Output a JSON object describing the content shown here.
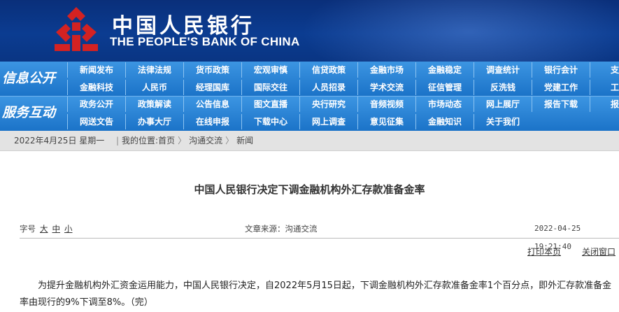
{
  "header": {
    "bank_name_cn": "中国人民银行",
    "bank_name_en": "THE PEOPLE'S BANK OF CHINA",
    "logo_icon": "pboc-logo-icon",
    "logo_color": "#d32222"
  },
  "nav": {
    "section1_label": "信息公开",
    "section2_label": "服务互动",
    "row1": [
      "新闻发布",
      "法律法规",
      "货币政策",
      "宏观审慎",
      "信贷政策",
      "金融市场",
      "金融稳定",
      "调查统计",
      "银行会计",
      "支付"
    ],
    "row2": [
      "金融科技",
      "人民币",
      "经理国库",
      "国际交往",
      "人员招录",
      "学术交流",
      "征信管理",
      "反洗钱",
      "党建工作",
      "工会"
    ],
    "row3": [
      "政务公开",
      "政策解读",
      "公告信息",
      "图文直播",
      "央行研究",
      "音频视频",
      "市场动态",
      "网上展厅",
      "报告下载",
      "报刊"
    ],
    "row4": [
      "网送文告",
      "办事大厅",
      "在线申报",
      "下载中心",
      "网上调查",
      "意见征集",
      "金融知识",
      "关于我们"
    ]
  },
  "breadcrumb": {
    "date": "2022年4月25日 星期一",
    "prefix": "我的位置:",
    "items": [
      "首页",
      "沟通交流",
      "新闻"
    ]
  },
  "article": {
    "title": "中国人民银行决定下调金融机构外汇存款准备金率",
    "font_size_label": "字号",
    "font_size_options": [
      "大",
      "中",
      "小"
    ],
    "source": "文章来源：沟通交流",
    "time": "2022-04-25 19:21:40",
    "print_label": "打印本页",
    "close_label": "关闭窗口",
    "body": "为提升金融机构外汇资金运用能力，中国人民银行决定，自2022年5月15日起，下调金融机构外汇存款准备金率1个百分点，即外汇存款准备金率由现行的9%下调至8%。（完）"
  }
}
